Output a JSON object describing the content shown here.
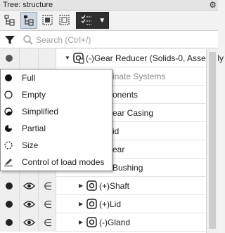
{
  "window": {
    "title": "Tree: structure",
    "settings_icon": "gear-icon"
  },
  "toolbar": {
    "buttons": [
      {
        "name": "structure-tree-view",
        "icon": "tree-structure-icon",
        "active": false
      },
      {
        "name": "dependency-tree-view",
        "icon": "tree-dependency-icon",
        "active": true
      },
      {
        "name": "select-all",
        "icon": "select-all-icon",
        "active": false
      },
      {
        "name": "select-box",
        "icon": "select-box-icon",
        "active": false
      }
    ],
    "dropdown": {
      "icon": "checklist-icon",
      "arrow": "▼"
    }
  },
  "filter": {
    "icon": "funnel-icon",
    "search_icon": "magnifier-icon",
    "placeholder": "Search (Ctrl+/)",
    "value": ""
  },
  "tree": {
    "rows": [
      {
        "label": "(-)Gear Reducer (Solids-0, Assembly",
        "prefix_icon": "assembly-icon",
        "grey": false,
        "dot": true,
        "eye": false,
        "sel": false,
        "level": 0,
        "expander": "▼"
      },
      {
        "label": "inate Systems",
        "prefix_icon": "",
        "grey": true,
        "dot": false,
        "eye": false,
        "sel": false,
        "level": 1,
        "expander": ""
      },
      {
        "label": "onents",
        "prefix_icon": "",
        "grey": false,
        "dot": false,
        "eye": false,
        "sel": false,
        "level": 1,
        "expander": ""
      },
      {
        "label": "ear Casing",
        "prefix_icon": "",
        "grey": false,
        "dot": false,
        "eye": false,
        "sel": false,
        "level": 1,
        "expander": ""
      },
      {
        "label": "id",
        "prefix_icon": "",
        "grey": false,
        "dot": false,
        "eye": false,
        "sel": false,
        "level": 1,
        "expander": ""
      },
      {
        "label": "ear",
        "prefix_icon": "",
        "grey": false,
        "dot": false,
        "eye": false,
        "sel": false,
        "level": 1,
        "expander": ""
      },
      {
        "label": "Bushing",
        "prefix_icon": "part-icon",
        "grey": false,
        "dot": true,
        "eye": true,
        "sel": true,
        "level": 1,
        "expander": ""
      },
      {
        "label": "(+)Shaft",
        "prefix_icon": "part-icon",
        "grey": false,
        "dot": true,
        "eye": true,
        "sel": true,
        "level": 1,
        "expander": "▶"
      },
      {
        "label": "(+)Lid",
        "prefix_icon": "part-icon",
        "grey": false,
        "dot": true,
        "eye": true,
        "sel": true,
        "level": 1,
        "expander": "▶"
      },
      {
        "label": "(-)Gland",
        "prefix_icon": "part-icon",
        "grey": false,
        "dot": true,
        "eye": true,
        "sel": true,
        "level": 1,
        "expander": "▶"
      }
    ]
  },
  "context_menu": {
    "items": [
      {
        "label": "Full",
        "icon": "full-dot-icon"
      },
      {
        "label": "Empty",
        "icon": "empty-circle-icon"
      },
      {
        "label": "Simplified",
        "icon": "simplified-circle-icon"
      },
      {
        "label": "Partial",
        "icon": "partial-circle-icon"
      },
      {
        "label": "Size",
        "icon": "dashed-circle-icon"
      },
      {
        "label": "Control of load modes",
        "icon": "pencil-icon"
      }
    ]
  },
  "colors": {
    "toolbar_dropdown": "#2f2f2f",
    "active_button": "#cfd8e3",
    "column_bg": "#efefef"
  }
}
